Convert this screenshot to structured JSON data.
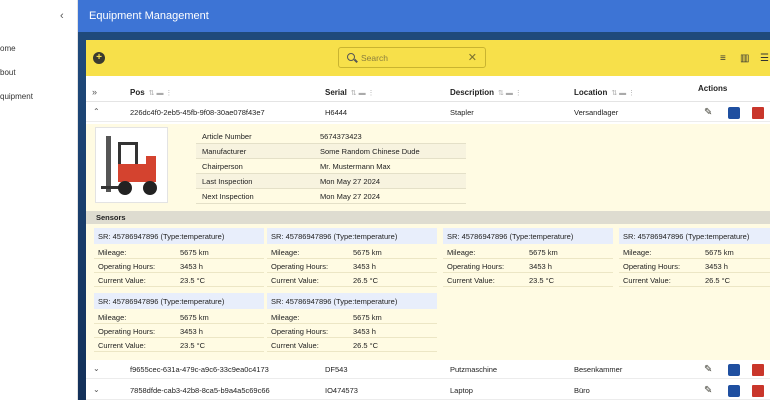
{
  "sidebar": {
    "items": [
      {
        "label": "ome"
      },
      {
        "label": "bout"
      },
      {
        "label": "quipment"
      }
    ]
  },
  "header": {
    "title": "Equipment Management"
  },
  "toolbar": {
    "search_placeholder": "Search"
  },
  "table": {
    "columns": [
      {
        "label": "Pos"
      },
      {
        "label": "Serial"
      },
      {
        "label": "Description"
      },
      {
        "label": "Location"
      },
      {
        "label": "Actions"
      }
    ],
    "rows": [
      {
        "pos": "226dc4f0-2eb5-45fb-9f08-30ae078f43e7",
        "serial": "H6444",
        "description": "Stapler",
        "location": "Versandlager"
      },
      {
        "pos": "f9655cec-631a-479c-a9c6-33c9ea0c4173",
        "serial": "DF543",
        "description": "Putzmaschine",
        "location": "Besenkammer"
      },
      {
        "pos": "7858dfde-cab3-42b8-8ca5-b9a4a5c69c66",
        "serial": "IO474573",
        "description": "Laptop",
        "location": "Büro"
      }
    ]
  },
  "detail": {
    "info": [
      {
        "key": "Article Number",
        "value": "5674373423"
      },
      {
        "key": "Manufacturer",
        "value": "Some Random Chinese Dude"
      },
      {
        "key": "Chairperson",
        "value": "Mr. Mustermann Max"
      },
      {
        "key": "Last Inspection",
        "value": "Mon May 27 2024"
      },
      {
        "key": "Next Inspection",
        "value": "Mon May 27 2024"
      }
    ],
    "sensors_title": "Sensors",
    "sensor_labels": {
      "mileage": "Mileage:",
      "hours": "Operating Hours:",
      "value": "Current Value:"
    },
    "sensors": [
      {
        "title": "SR: 45786947896 (Type:temperature)",
        "mileage": "5675 km",
        "hours": "3453 h",
        "value": "23.5 °C"
      },
      {
        "title": "SR: 45786947896 (Type:temperature)",
        "mileage": "5675 km",
        "hours": "3453 h",
        "value": "26.5 °C"
      },
      {
        "title": "SR: 45786947896 (Type:temperature)",
        "mileage": "5675 km",
        "hours": "3453 h",
        "value": "23.5 °C"
      },
      {
        "title": "SR: 45786947896 (Type:temperature)",
        "mileage": "5675 km",
        "hours": "3453 h",
        "value": "26.5 °C"
      },
      {
        "title": "SR: 45786947896 (Type:temperature)",
        "mileage": "5675 km",
        "hours": "3453 h",
        "value": "23.5 °C"
      },
      {
        "title": "SR: 45786947896 (Type:temperature)",
        "mileage": "5675 km",
        "hours": "3453 h",
        "value": "26.5 °C"
      }
    ]
  },
  "colors": {
    "header": "#3d74d5",
    "toolbar": "#f7e04a",
    "detail_bg": "#fffbe3",
    "edit": "#3a3a30",
    "clipboard": "#1f4fa0",
    "delete": "#c9362b"
  }
}
